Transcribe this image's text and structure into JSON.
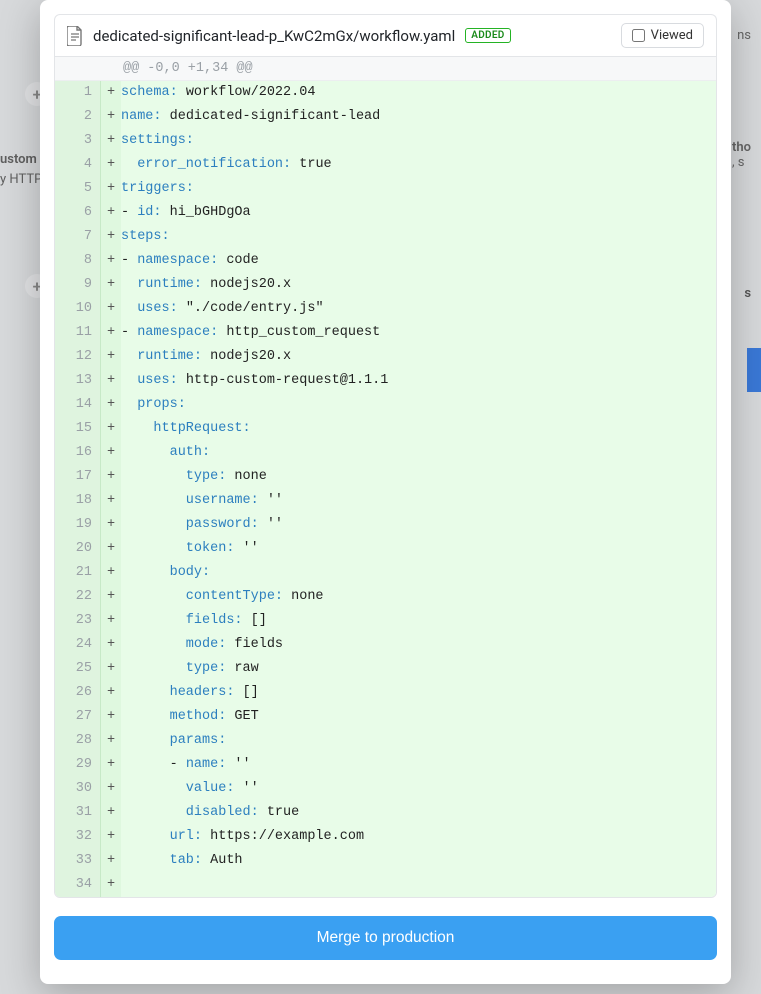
{
  "background": {
    "left_title": "ustom",
    "left_subtitle": "y HTTP",
    "right_tho": "tho",
    "right_sc": ", s",
    "right_tab": "s",
    "ns": "ns"
  },
  "file": {
    "name": "dedicated-significant-lead-p_KwC2mGx/workflow.yaml",
    "badge": "ADDED",
    "viewed_label": "Viewed",
    "viewed_checked": false
  },
  "hunk_header": "@@ -0,0 +1,34 @@",
  "merge_label": "Merge to production",
  "lines": [
    {
      "n": 1,
      "segments": [
        {
          "t": "schema:",
          "c": "k"
        },
        {
          "t": " workflow/2022.04",
          "c": "v"
        }
      ]
    },
    {
      "n": 2,
      "segments": [
        {
          "t": "name:",
          "c": "k"
        },
        {
          "t": " dedicated-significant-lead",
          "c": "v"
        }
      ]
    },
    {
      "n": 3,
      "segments": [
        {
          "t": "settings:",
          "c": "k"
        }
      ]
    },
    {
      "n": 4,
      "segments": [
        {
          "t": "  error_notification:",
          "c": "k"
        },
        {
          "t": " true",
          "c": "v"
        }
      ]
    },
    {
      "n": 5,
      "segments": [
        {
          "t": "triggers:",
          "c": "k"
        }
      ]
    },
    {
      "n": 6,
      "segments": [
        {
          "t": "- ",
          "c": "v"
        },
        {
          "t": "id:",
          "c": "k"
        },
        {
          "t": " hi_bGHDgOa",
          "c": "v"
        }
      ]
    },
    {
      "n": 7,
      "segments": [
        {
          "t": "steps:",
          "c": "k"
        }
      ]
    },
    {
      "n": 8,
      "segments": [
        {
          "t": "- ",
          "c": "v"
        },
        {
          "t": "namespace:",
          "c": "k"
        },
        {
          "t": " code",
          "c": "v"
        }
      ]
    },
    {
      "n": 9,
      "segments": [
        {
          "t": "  runtime:",
          "c": "k"
        },
        {
          "t": " nodejs20.x",
          "c": "v"
        }
      ]
    },
    {
      "n": 10,
      "segments": [
        {
          "t": "  uses:",
          "c": "k"
        },
        {
          "t": " \"./code/entry.js\"",
          "c": "v"
        }
      ]
    },
    {
      "n": 11,
      "segments": [
        {
          "t": "- ",
          "c": "v"
        },
        {
          "t": "namespace:",
          "c": "k"
        },
        {
          "t": " http_custom_request",
          "c": "v"
        }
      ]
    },
    {
      "n": 12,
      "segments": [
        {
          "t": "  runtime:",
          "c": "k"
        },
        {
          "t": " nodejs20.x",
          "c": "v"
        }
      ]
    },
    {
      "n": 13,
      "segments": [
        {
          "t": "  uses:",
          "c": "k"
        },
        {
          "t": " http-custom-request@1.1.1",
          "c": "v"
        }
      ]
    },
    {
      "n": 14,
      "segments": [
        {
          "t": "  props:",
          "c": "k"
        }
      ]
    },
    {
      "n": 15,
      "segments": [
        {
          "t": "    httpRequest:",
          "c": "k"
        }
      ]
    },
    {
      "n": 16,
      "segments": [
        {
          "t": "      auth:",
          "c": "k"
        }
      ]
    },
    {
      "n": 17,
      "segments": [
        {
          "t": "        type:",
          "c": "k"
        },
        {
          "t": " none",
          "c": "v"
        }
      ]
    },
    {
      "n": 18,
      "segments": [
        {
          "t": "        username:",
          "c": "k"
        },
        {
          "t": " ''",
          "c": "v"
        }
      ]
    },
    {
      "n": 19,
      "segments": [
        {
          "t": "        password:",
          "c": "k"
        },
        {
          "t": " ''",
          "c": "v"
        }
      ]
    },
    {
      "n": 20,
      "segments": [
        {
          "t": "        token:",
          "c": "k"
        },
        {
          "t": " ''",
          "c": "v"
        }
      ]
    },
    {
      "n": 21,
      "segments": [
        {
          "t": "      body:",
          "c": "k"
        }
      ]
    },
    {
      "n": 22,
      "segments": [
        {
          "t": "        contentType:",
          "c": "k"
        },
        {
          "t": " none",
          "c": "v"
        }
      ]
    },
    {
      "n": 23,
      "segments": [
        {
          "t": "        fields:",
          "c": "k"
        },
        {
          "t": " []",
          "c": "v"
        }
      ]
    },
    {
      "n": 24,
      "segments": [
        {
          "t": "        mode:",
          "c": "k"
        },
        {
          "t": " fields",
          "c": "v"
        }
      ]
    },
    {
      "n": 25,
      "segments": [
        {
          "t": "        type:",
          "c": "k"
        },
        {
          "t": " raw",
          "c": "v"
        }
      ]
    },
    {
      "n": 26,
      "segments": [
        {
          "t": "      headers:",
          "c": "k"
        },
        {
          "t": " []",
          "c": "v"
        }
      ]
    },
    {
      "n": 27,
      "segments": [
        {
          "t": "      method:",
          "c": "k"
        },
        {
          "t": " GET",
          "c": "v"
        }
      ]
    },
    {
      "n": 28,
      "segments": [
        {
          "t": "      params:",
          "c": "k"
        }
      ]
    },
    {
      "n": 29,
      "segments": [
        {
          "t": "      - ",
          "c": "v"
        },
        {
          "t": "name:",
          "c": "k"
        },
        {
          "t": " ''",
          "c": "v"
        }
      ]
    },
    {
      "n": 30,
      "segments": [
        {
          "t": "        value:",
          "c": "k"
        },
        {
          "t": " ''",
          "c": "v"
        }
      ]
    },
    {
      "n": 31,
      "segments": [
        {
          "t": "        disabled:",
          "c": "k"
        },
        {
          "t": " true",
          "c": "v"
        }
      ]
    },
    {
      "n": 32,
      "segments": [
        {
          "t": "      url:",
          "c": "k"
        },
        {
          "t": " https://example.com",
          "c": "v"
        }
      ]
    },
    {
      "n": 33,
      "segments": [
        {
          "t": "      tab:",
          "c": "k"
        },
        {
          "t": " Auth",
          "c": "v"
        }
      ]
    },
    {
      "n": 34,
      "segments": []
    }
  ]
}
